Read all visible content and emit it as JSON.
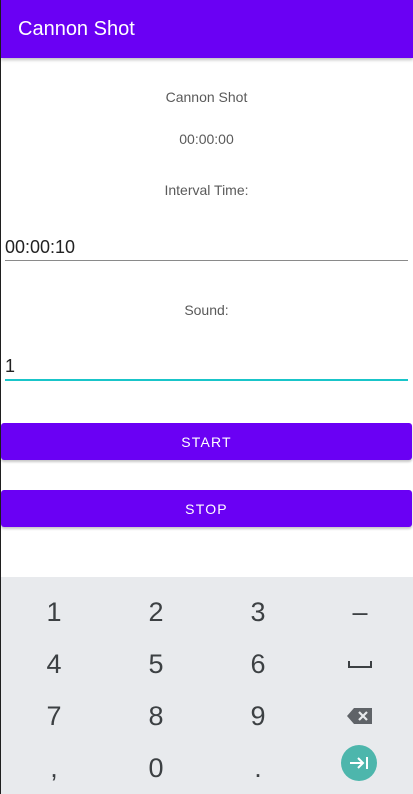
{
  "app_bar": {
    "title": "Cannon Shot"
  },
  "main": {
    "heading": "Cannon Shot",
    "timer": "00:00:00",
    "interval_label": "Interval Time:",
    "interval_value": "00:00:10",
    "sound_label": "Sound:",
    "sound_value": "1",
    "start_label": "START",
    "stop_label": "STOP"
  },
  "keyboard": {
    "keys": [
      "1",
      "2",
      "3",
      "–",
      "4",
      "5",
      "6",
      "space",
      "7",
      "8",
      "9",
      "backspace",
      ",",
      "0",
      ".",
      "next"
    ]
  },
  "colors": {
    "primary": "#6a00f4",
    "focus_underline": "#19c5c9",
    "keyboard_bg": "#e8eaed",
    "enter_key": "#4db6ac"
  }
}
